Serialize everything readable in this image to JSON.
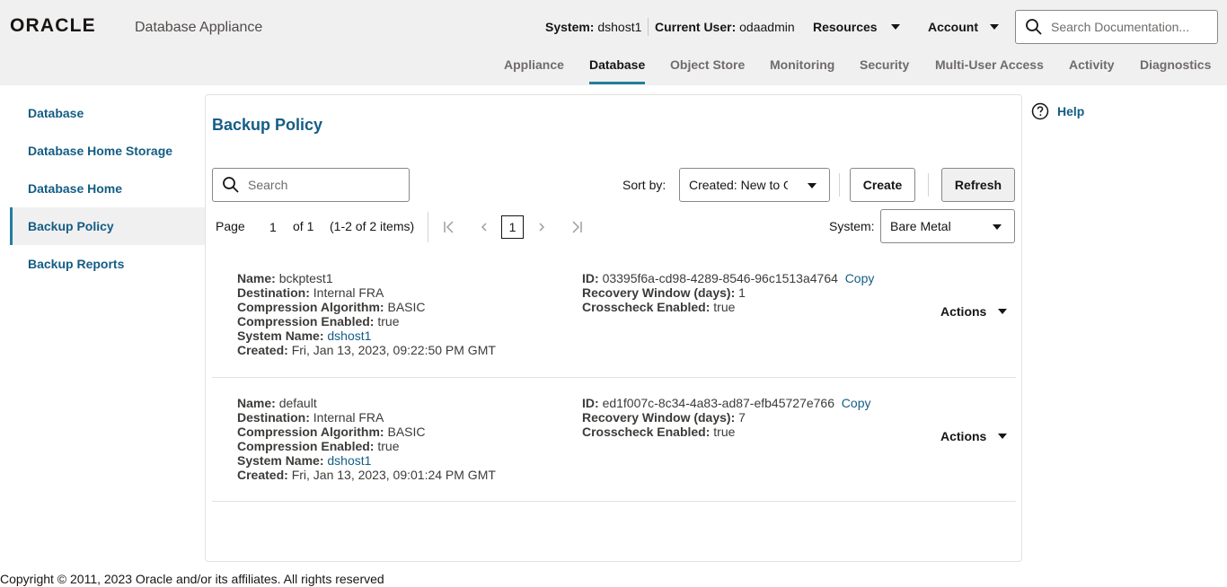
{
  "header": {
    "brand": "ORACLE",
    "product": "Database Appliance",
    "system_label": "System:",
    "system_value": "dshost1",
    "user_label": "Current User:",
    "user_value": "odaadmin",
    "resources": "Resources",
    "account": "Account",
    "search_placeholder": "Search Documentation..."
  },
  "nav": {
    "tabs": [
      {
        "label": "Appliance"
      },
      {
        "label": "Database"
      },
      {
        "label": "Object Store"
      },
      {
        "label": "Monitoring"
      },
      {
        "label": "Security"
      },
      {
        "label": "Multi-User Access"
      },
      {
        "label": "Activity"
      },
      {
        "label": "Diagnostics"
      }
    ],
    "active": "Database"
  },
  "sidebar": {
    "items": [
      {
        "label": "Database"
      },
      {
        "label": "Database Home Storage"
      },
      {
        "label": "Database Home"
      },
      {
        "label": "Backup Policy"
      },
      {
        "label": "Backup Reports"
      }
    ],
    "active": "Backup Policy"
  },
  "main": {
    "title": "Backup Policy",
    "search_placeholder": "Search",
    "sort_label": "Sort by:",
    "sort_value": "Created: New to Old",
    "create_label": "Create",
    "refresh_label": "Refresh",
    "system_label": "System:",
    "system_value": "Bare Metal",
    "pager": {
      "page_label": "Page",
      "page_value": "1",
      "of_label": "of 1",
      "items_label": "(1-2 of 2 items)",
      "current": "1"
    }
  },
  "records": [
    {
      "name_label": "Name:",
      "name": "bckptest1",
      "dest_label": "Destination:",
      "dest": "Internal FRA",
      "algo_label": "Compression Algorithm:",
      "algo": "BASIC",
      "comp_label": "Compression Enabled:",
      "comp": "true",
      "sysname_label": "System Name:",
      "sysname": "dshost1",
      "created_label": "Created:",
      "created": "Fri, Jan 13, 2023, 09:22:50 PM GMT",
      "id_label": "ID:",
      "id": "03395f6a-cd98-4289-8546-96c1513a4764",
      "copy_label": "Copy",
      "window_label": "Recovery Window (days):",
      "window": "1",
      "cross_label": "Crosscheck Enabled:",
      "cross": "true",
      "actions_label": "Actions"
    },
    {
      "name_label": "Name:",
      "name": "default",
      "dest_label": "Destination:",
      "dest": "Internal FRA",
      "algo_label": "Compression Algorithm:",
      "algo": "BASIC",
      "comp_label": "Compression Enabled:",
      "comp": "true",
      "sysname_label": "System Name:",
      "sysname": "dshost1",
      "created_label": "Created:",
      "created": "Fri, Jan 13, 2023, 09:01:24 PM GMT",
      "id_label": "ID:",
      "id": "ed1f007c-8c34-4a83-ad87-efb45727e766",
      "copy_label": "Copy",
      "window_label": "Recovery Window (days):",
      "window": "7",
      "cross_label": "Crosscheck Enabled:",
      "cross": "true",
      "actions_label": "Actions"
    }
  ],
  "help": "Help",
  "footer": "Copyright © 2011, 2023 Oracle and/or its affiliates. All rights reserved"
}
